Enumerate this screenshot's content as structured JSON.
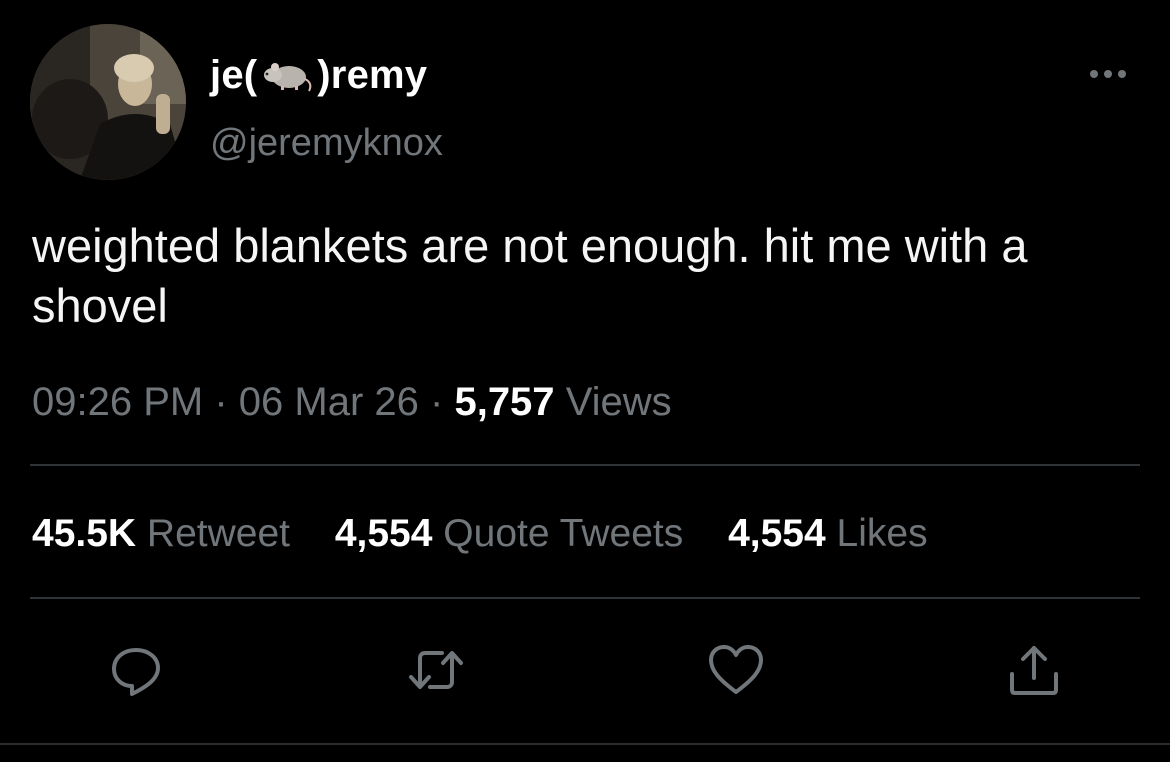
{
  "user": {
    "name_prefix": "je(",
    "name_emoji": "rat-icon",
    "name_suffix": ")remy",
    "handle": "@jeremyknox"
  },
  "tweet": {
    "text": "weighted blankets are not enough. hit me with a shovel",
    "time": "09:26 PM",
    "date": "06 Mar 26",
    "views_count": "5,757",
    "views_label": "Views"
  },
  "stats": {
    "retweets_count": "45.5K",
    "retweets_label": "Retweet",
    "quotes_count": "4,554",
    "quotes_label": "Quote Tweets",
    "likes_count": "4,554",
    "likes_label": "Likes"
  },
  "icons": {
    "more": "more-icon",
    "reply": "reply-icon",
    "retweet": "retweet-icon",
    "like": "heart-icon",
    "share": "share-icon"
  },
  "colors": {
    "background": "#000000",
    "text": "#ffffff",
    "secondary": "#71767b",
    "divider": "#2f3336"
  }
}
